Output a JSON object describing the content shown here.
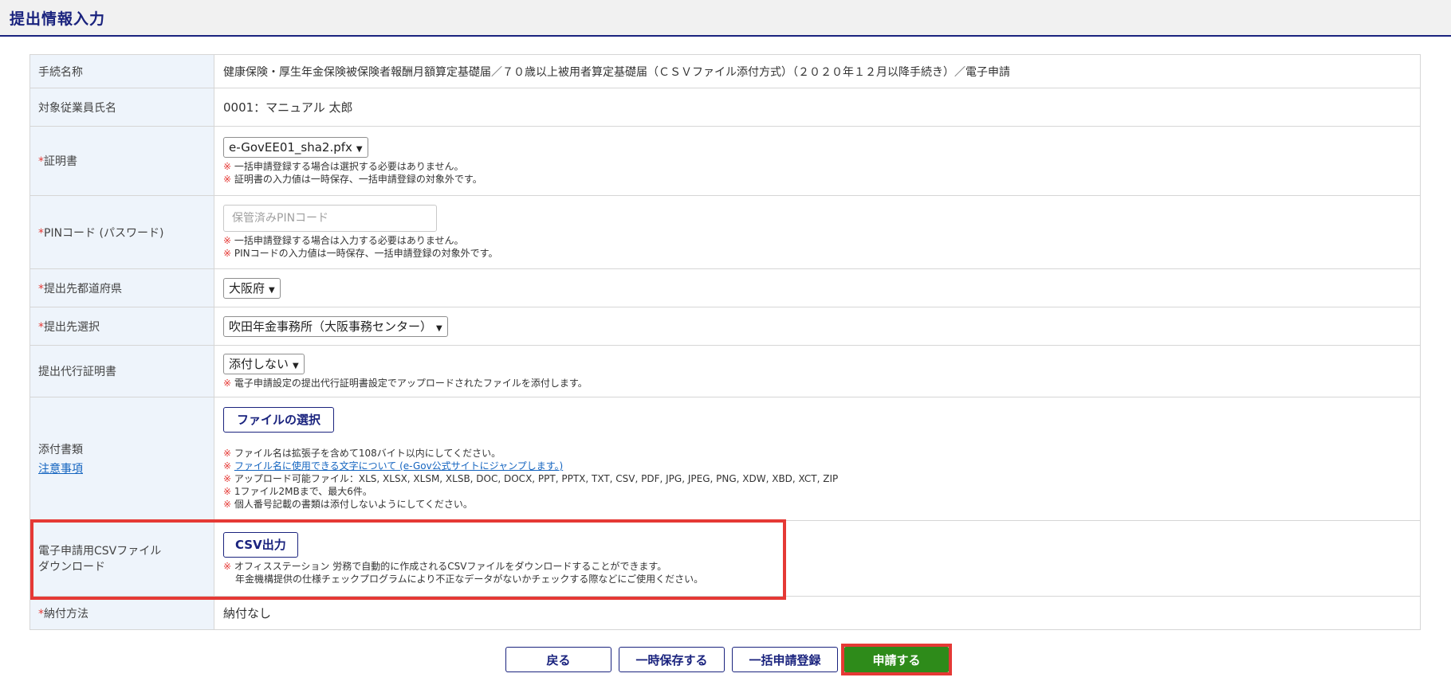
{
  "header": {
    "title": "提出情報入力"
  },
  "rows": {
    "procedure": {
      "label": "手続名称",
      "value": "健康保険・厚生年金保険被保険者報酬月額算定基礎届／７０歳以上被用者算定基礎届（ＣＳＶファイル添付方式）（２０２０年１２月以降手続き）／電子申請"
    },
    "employee": {
      "label": "対象従業員氏名",
      "value": "0001：マニュアル 太郎"
    },
    "certificate": {
      "required": "*",
      "label": "証明書",
      "selected": "e-GovEE01_sha2.pfx",
      "note_mark": "※",
      "notes": [
        "一括申請登録する場合は選択する必要はありません。",
        "証明書の入力値は一時保存、一括申請登録の対象外です。"
      ]
    },
    "pin": {
      "required": "*",
      "label": "PINコード (パスワード)",
      "placeholder": "保管済みPINコード",
      "note_mark": "※",
      "notes": [
        "一括申請登録する場合は入力する必要はありません。",
        "PINコードの入力値は一時保存、一括申請登録の対象外です。"
      ]
    },
    "prefecture": {
      "required": "*",
      "label": "提出先都道府県",
      "selected": "大阪府"
    },
    "office": {
      "required": "*",
      "label": "提出先選択",
      "selected": "吹田年金事務所（大阪事務センター）"
    },
    "proxy_cert": {
      "label": "提出代行証明書",
      "selected": "添付しない",
      "note_mark": "※",
      "notes": [
        "電子申請設定の提出代行証明書設定でアップロードされたファイルを添付します。"
      ]
    },
    "attachments": {
      "label": "添付書類",
      "caution_link": "注意事項",
      "button": "ファイルの選択",
      "note_mark": "※",
      "notes": [
        "ファイル名は拡張子を含めて108バイト以内にしてください。",
        "ファイル名に使用できる文字について (e-Gov公式サイトにジャンプします。)",
        "アップロード可能ファイル：XLS, XLSX, XLSM, XLSB, DOC, DOCX, PPT, PPTX, TXT, CSV, PDF, JPG, JPEG, PNG, XDW, XBD, XCT, ZIP",
        "1ファイル2MBまで、最大6件。",
        "個人番号記載の書類は添付しないようにしてください。"
      ]
    },
    "csv_download": {
      "label_line1": "電子申請用CSVファイル",
      "label_line2": "ダウンロード",
      "button": "CSV出力",
      "note_mark": "※",
      "notes": [
        "オフィスステーション 労務で自動的に作成されるCSVファイルをダウンロードすることができます。",
        "年金機構提供の仕様チェックプログラムにより不正なデータがないかチェックする際などにご使用ください。"
      ]
    },
    "payment": {
      "required": "*",
      "label": "納付方法",
      "value": "納付なし"
    }
  },
  "buttons": {
    "back": "戻る",
    "temp_save": "一時保存する",
    "bulk_register": "一括申請登録",
    "apply": "申請する"
  },
  "colors": {
    "accent_navy": "#1a237e",
    "highlight_red": "#e53935",
    "apply_green": "#2e8b1a",
    "label_bg": "#eef4fb"
  }
}
